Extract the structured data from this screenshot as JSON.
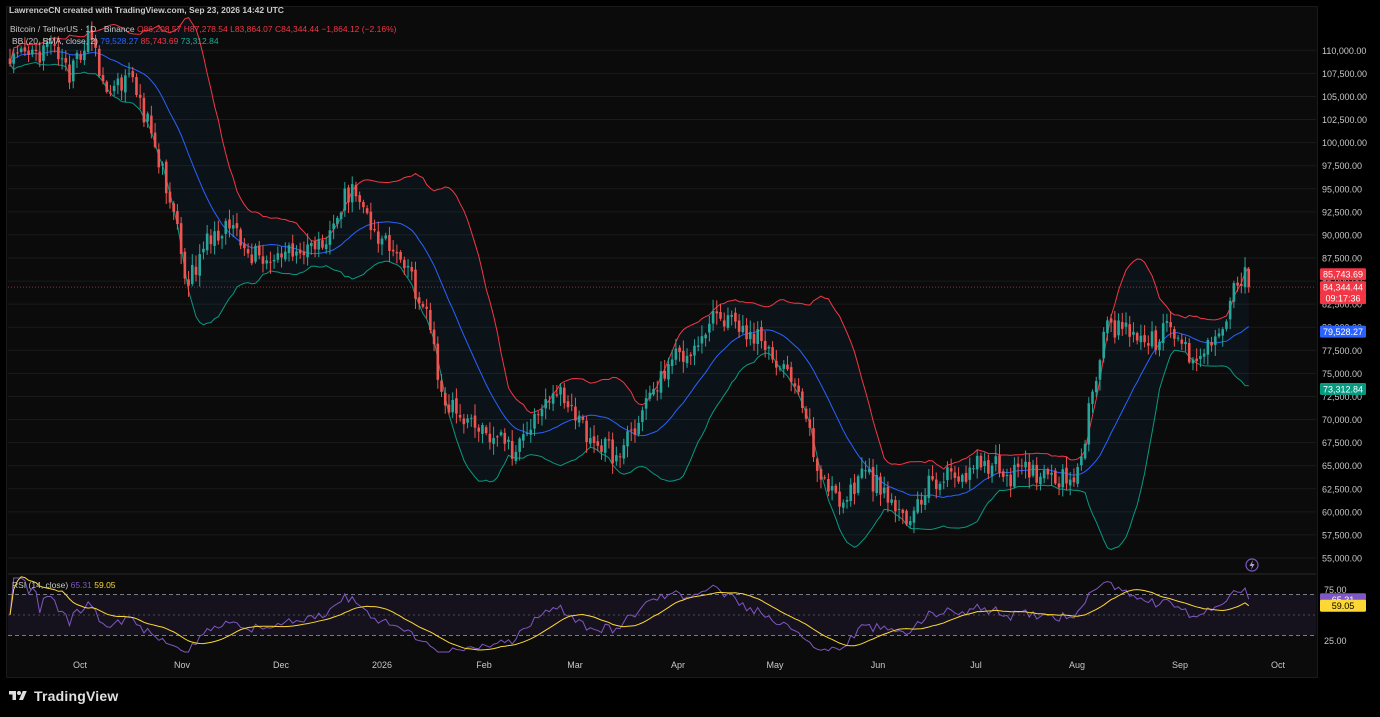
{
  "header": {
    "attribution": "LawrenceCN created with TradingView.com, Sep 23, 2026 14:42 UTC",
    "symbol": "Bitcoin / TetherUS · 1D · Binance",
    "ohlc_open": "O86,208.57",
    "ohlc_high": "H87,278.54",
    "ohlc_low": "L83,864.07",
    "ohlc_close": "C84,344.44",
    "ohlc_change": "−1,864.12 (−2.16%)",
    "bb_label": "BB (20, SMA, close, 2)",
    "bb_basis": "79,528.27",
    "bb_upper": "85,743.69",
    "bb_lower": "73,312.84",
    "rsi_label": "RSI (14, close)",
    "rsi_value": "65.31",
    "rsi_ma": "59.05"
  },
  "price_labels": {
    "upper_band": "85,743.69",
    "last_price": "84,344.44",
    "countdown": "09:17:36",
    "basis": "79,528.27",
    "lower_band": "73,312.84",
    "rsi": "65.31",
    "rsi_ma": "59.05"
  },
  "colors": {
    "up": "#26a69a",
    "down": "#ef5350",
    "bb_upper": "#f23645",
    "bb_basis": "#2962ff",
    "bb_lower": "#089981",
    "rsi": "#7e57c2",
    "rsi_ma": "#fdd835",
    "background": "#0b0b0b"
  },
  "footer": {
    "brand": "TradingView"
  },
  "chart_data": [
    {
      "type": "candlestick",
      "title": "Bitcoin / TetherUS · 1D · Binance",
      "y_ticks": [
        "110,000.00",
        "107,500.00",
        "105,000.00",
        "102,500.00",
        "100,000.00",
        "97,500.00",
        "95,000.00",
        "92,500.00",
        "90,000.00",
        "87,500.00",
        "85,000.00",
        "82,500.00",
        "80,000.00",
        "77,500.00",
        "75,000.00",
        "72,500.00",
        "70,000.00",
        "67,500.00",
        "65,000.00",
        "62,500.00",
        "60,000.00",
        "57,500.00",
        "55,000.00"
      ],
      "ylim": [
        53700,
        112200
      ],
      "x_ticks": [
        "Oct",
        "Nov",
        "Dec",
        "2026",
        "Feb",
        "Mar",
        "Apr",
        "May",
        "Jun",
        "Jul",
        "Aug",
        "Sep",
        "Oct"
      ],
      "anchors": [
        [
          0,
          108500
        ],
        [
          12,
          110500
        ],
        [
          16,
          106500
        ],
        [
          21,
          112000
        ],
        [
          26,
          105500
        ],
        [
          32,
          107500
        ],
        [
          38,
          101000
        ],
        [
          44,
          92500
        ],
        [
          48,
          84500
        ],
        [
          52,
          88500
        ],
        [
          58,
          91500
        ],
        [
          64,
          88000
        ],
        [
          70,
          87000
        ],
        [
          78,
          88000
        ],
        [
          86,
          90500
        ],
        [
          92,
          95500
        ],
        [
          98,
          90500
        ],
        [
          104,
          88000
        ],
        [
          112,
          82000
        ],
        [
          116,
          73000
        ],
        [
          122,
          69500
        ],
        [
          130,
          68000
        ],
        [
          136,
          66500
        ],
        [
          142,
          70500
        ],
        [
          148,
          73500
        ],
        [
          156,
          68000
        ],
        [
          164,
          66000
        ],
        [
          170,
          71000
        ],
        [
          178,
          76500
        ],
        [
          184,
          78000
        ],
        [
          190,
          81500
        ],
        [
          196,
          79500
        ],
        [
          202,
          78500
        ],
        [
          208,
          76000
        ],
        [
          212,
          73000
        ],
        [
          218,
          63500
        ],
        [
          224,
          61000
        ],
        [
          230,
          64500
        ],
        [
          236,
          61000
        ],
        [
          242,
          59000
        ],
        [
          248,
          63500
        ],
        [
          256,
          64000
        ],
        [
          262,
          65500
        ],
        [
          268,
          64000
        ],
        [
          278,
          64500
        ],
        [
          285,
          63500
        ],
        [
          288,
          66000
        ],
        [
          294,
          79500
        ],
        [
          300,
          80500
        ],
        [
          306,
          78000
        ],
        [
          312,
          80000
        ],
        [
          318,
          76500
        ],
        [
          324,
          79000
        ],
        [
          330,
          84500
        ],
        [
          332,
          86500
        ],
        [
          333,
          84344
        ]
      ],
      "bollinger": {
        "period": 20,
        "mult": 2,
        "upper_last": 85743.69,
        "basis_last": 79528.27,
        "lower_last": 73312.84
      },
      "last_price": 84344.44
    },
    {
      "type": "line",
      "title": "RSI (14, close)",
      "y_ticks": [
        "75.00",
        "25.00"
      ],
      "ylim": [
        14,
        86
      ],
      "bands": {
        "upper": 70,
        "middle": 50,
        "lower": 30
      },
      "last_rsi": 65.31,
      "last_ma": 59.05
    }
  ]
}
